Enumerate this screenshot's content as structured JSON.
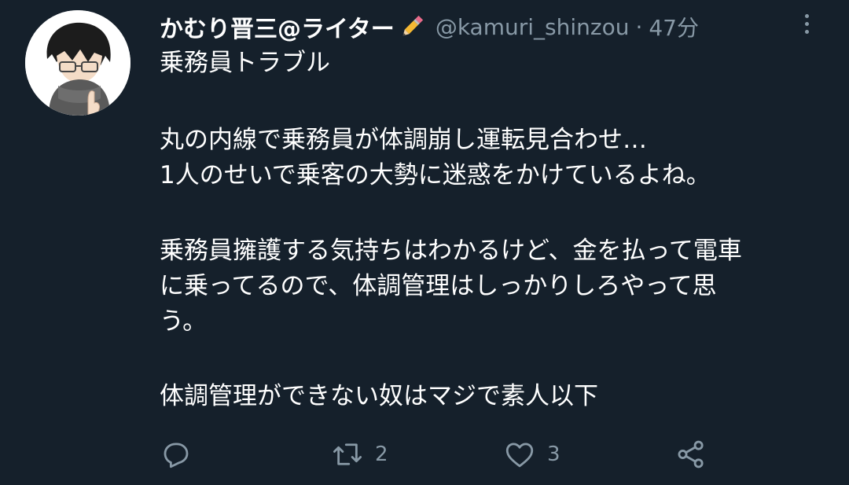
{
  "tweet": {
    "display_name": "かむり晋三@ライター",
    "name_emoji_icon": "pencil-icon",
    "handle": "@kamuri_shinzou",
    "separator": "·",
    "time": "47分",
    "lines": [
      "乗務員トラブル",
      "丸の内線で乗務員が体調崩し運転見合わせ…",
      "1人のせいで乗客の大勢に迷惑をかけているよね。",
      "乗務員擁護する気持ちはわかるけど、金を払って電車",
      "に乗ってるので、体調管理はしっかりしろやって思",
      "う。",
      "体調管理ができない奴はマジで素人以下"
    ]
  },
  "actions": {
    "reply": {
      "icon": "reply-icon",
      "count": ""
    },
    "retweet": {
      "icon": "retweet-icon",
      "count": "2"
    },
    "like": {
      "icon": "heart-icon",
      "count": "3"
    },
    "share": {
      "icon": "share-icon",
      "count": ""
    }
  },
  "colors": {
    "background": "#15202b",
    "text": "#ffffff",
    "secondary": "#8899a6"
  }
}
